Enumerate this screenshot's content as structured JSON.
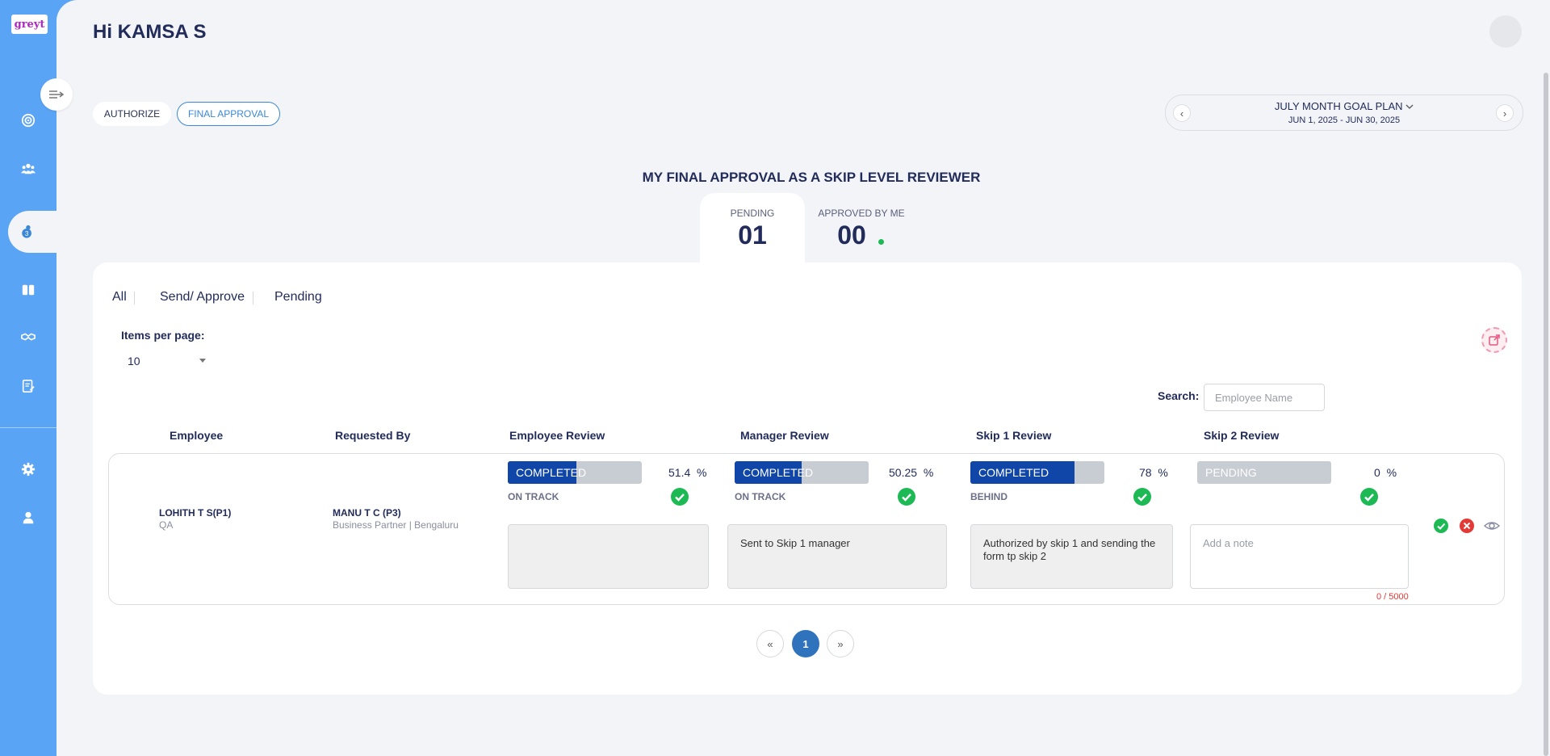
{
  "app": {
    "logo_text": "greyt"
  },
  "header": {
    "greeting": "Hi KAMSA S"
  },
  "tabs": {
    "authorize": "AUTHORIZE",
    "final_approval": "FINAL APPROVAL"
  },
  "plan": {
    "title": "JULY MONTH GOAL PLAN",
    "dates": "JUN 1, 2025 - JUN 30, 2025"
  },
  "section_title": "MY FINAL APPROVAL AS A SKIP LEVEL REVIEWER",
  "stats": {
    "pending_label": "PENDING",
    "pending_value": "01",
    "approved_label": "APPROVED BY ME",
    "approved_value": "00"
  },
  "filters": {
    "all": "All",
    "send_approve": "Send/ Approve",
    "pending": "Pending"
  },
  "items_per_page": {
    "label": "Items per page:",
    "value": "10"
  },
  "search": {
    "label": "Search:",
    "placeholder": "Employee Name"
  },
  "table": {
    "headers": {
      "employee": "Employee",
      "requested_by": "Requested By",
      "employee_review": "Employee Review",
      "manager_review": "Manager Review",
      "skip1_review": "Skip 1 Review",
      "skip2_review": "Skip 2 Review"
    },
    "rows": [
      {
        "employee_name": "LOHITH T S(P1)",
        "employee_dept": "QA",
        "requester_name": "MANU T C (P3)",
        "requester_info": "Business Partner | Bengaluru",
        "employee_review": {
          "status": "COMPLETED",
          "percent": "51.4",
          "unit": "%",
          "track": "ON TRACK",
          "fill": 0.514,
          "note": ""
        },
        "manager_review": {
          "status": "COMPLETED",
          "percent": "50.25",
          "unit": "%",
          "track": "ON TRACK",
          "fill": 0.5025,
          "note": "Sent to Skip 1 manager"
        },
        "skip1_review": {
          "status": "COMPLETED",
          "percent": "78",
          "unit": "%",
          "track": "BEHIND",
          "fill": 0.78,
          "note": "Authorized by skip 1 and sending the form tp skip 2"
        },
        "skip2_review": {
          "status": "PENDING",
          "percent": "0",
          "unit": "%",
          "fill": 0.0,
          "note_placeholder": "Add a note",
          "char_count": "0 / 5000"
        }
      }
    ]
  },
  "pagination": {
    "prev": "«",
    "current": "1",
    "next": "»"
  },
  "colors": {
    "sidebar": "#5aa4f5",
    "progress_fill": "#0f46a8",
    "progress_track": "#c8ccd3",
    "check_green": "#1db954",
    "reject_red": "#e53935",
    "primary_blue": "#3b88d6"
  },
  "icons": {
    "sidebar": [
      "target-icon",
      "team-icon",
      "user-badge-icon",
      "book-icon",
      "handshake-icon",
      "form-edit-icon",
      "gear-icon",
      "user-icon"
    ],
    "row_actions": [
      "approve-check-icon",
      "reject-icon",
      "view-eye-icon"
    ]
  },
  "sidebar_badge": "3"
}
